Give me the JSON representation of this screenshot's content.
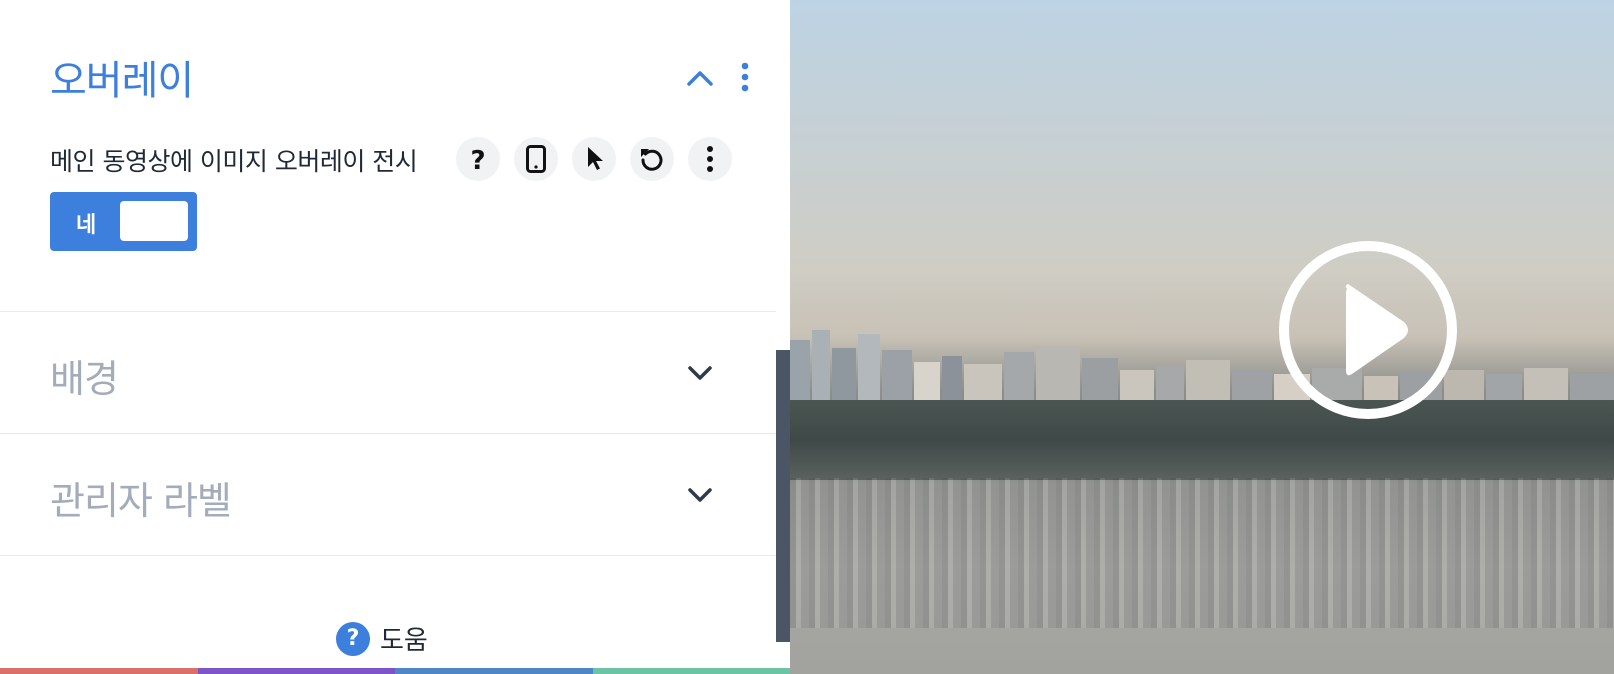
{
  "overlay_section": {
    "title": "오버레이",
    "field_label": "메인 동영상에 이미지 오버레이 전시",
    "toggle_label": "네",
    "toggle_on": true,
    "field_icons": [
      "help-icon",
      "mobile-icon",
      "cursor-icon",
      "reset-icon",
      "more-vertical-icon"
    ],
    "header_icons": [
      "chevron-up-icon",
      "more-vertical-icon"
    ]
  },
  "collapsed_sections": {
    "background_title": "배경",
    "admin_label_title": "관리자 라벨"
  },
  "help": {
    "icon_text": "?",
    "label": "도움"
  },
  "colors": {
    "accent": "#3d7fdc",
    "muted_title": "#a3acba",
    "scrollbar": "#4a5565",
    "bottom_bar": [
      "#d9706a",
      "#7e55c9",
      "#4f86c6",
      "#6cc4a4"
    ]
  },
  "video": {
    "play_icon": "play-circle-icon"
  }
}
